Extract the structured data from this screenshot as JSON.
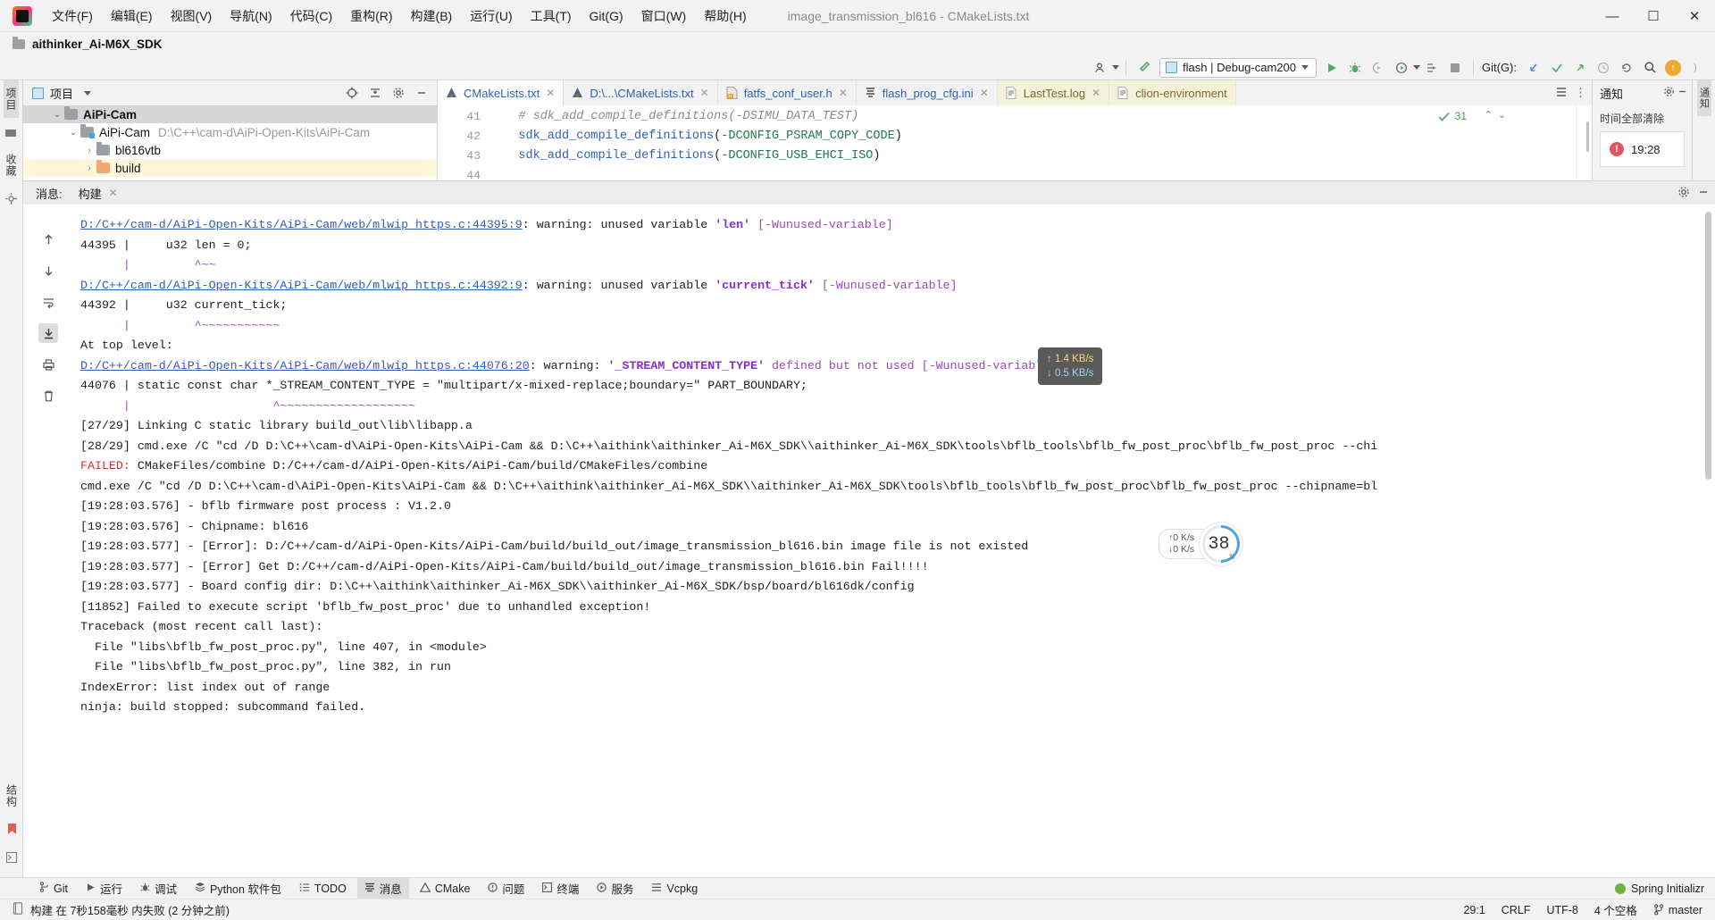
{
  "window": {
    "title": "image_transmission_bl616 - CMakeLists.txt",
    "minimize": "—",
    "maximize": "☐",
    "close": "✕"
  },
  "menu": [
    {
      "label": "文件(F)"
    },
    {
      "label": "编辑(E)"
    },
    {
      "label": "视图(V)"
    },
    {
      "label": "导航(N)"
    },
    {
      "label": "代码(C)"
    },
    {
      "label": "重构(R)"
    },
    {
      "label": "构建(B)"
    },
    {
      "label": "运行(U)"
    },
    {
      "label": "工具(T)"
    },
    {
      "label": "Git(G)"
    },
    {
      "label": "窗口(W)"
    },
    {
      "label": "帮助(H)"
    }
  ],
  "pathbar": {
    "project": "aithinker_Ai-M6X_SDK"
  },
  "toolbar": {
    "run_config": "flash | Debug-cam200",
    "git_label": "Git(G):",
    "update_badge": "↑"
  },
  "left_strip": {
    "project_tab": "项目",
    "bookmarks_tab": "收藏"
  },
  "left_strip_bottom": {
    "structure_tab": "结构"
  },
  "project_panel": {
    "title": "项目",
    "tree": [
      {
        "label": "AiPi-Cam",
        "path": "",
        "depth": 0,
        "arrow": "⌄",
        "icon": "grey",
        "bold": true,
        "selected": true
      },
      {
        "label": "AiPi-Cam",
        "path": "D:\\C++\\cam-d\\AiPi-Open-Kits\\AiPi-Cam",
        "depth": 1,
        "arrow": "⌄",
        "icon": "green",
        "bold": false,
        "selected": false
      },
      {
        "label": "bl616vtb",
        "path": "",
        "depth": 2,
        "arrow": "›",
        "icon": "grey",
        "bold": false,
        "selected": false
      },
      {
        "label": "build",
        "path": "",
        "depth": 2,
        "arrow": "›",
        "icon": "orange",
        "bold": false,
        "selected": false,
        "highlight": true
      }
    ]
  },
  "editor_tabs": [
    {
      "label": "CMakeLists.txt",
      "icon": "cmake",
      "active": true,
      "kind": "code"
    },
    {
      "label": "D:\\...\\CMakeLists.txt",
      "icon": "cmake",
      "active": false,
      "kind": "code"
    },
    {
      "label": "fatfs_conf_user.h",
      "icon": "hfile",
      "active": false,
      "kind": "code"
    },
    {
      "label": "flash_prog_cfg.ini",
      "icon": "ini",
      "active": false,
      "kind": "code"
    },
    {
      "label": "LastTest.log",
      "icon": "log",
      "active": false,
      "kind": "log"
    },
    {
      "label": "clion-environment",
      "icon": "log",
      "active": false,
      "kind": "log"
    }
  ],
  "editor": {
    "inspection_count": "31",
    "lines": [
      {
        "num": "41",
        "segments": [
          {
            "t": "    # sdk_add_compile_definitions(-DSIMU_DATA_TEST)",
            "c": "c-com"
          }
        ]
      },
      {
        "num": "42",
        "segments": [
          {
            "t": "    ",
            "c": "c-plain"
          },
          {
            "t": "sdk_add_compile_definitions",
            "c": "c-fn"
          },
          {
            "t": "(",
            "c": "c-plain"
          },
          {
            "t": "-DCONFIG_PSRAM_COPY_CODE",
            "c": "c-arg"
          },
          {
            "t": ")",
            "c": "c-plain"
          }
        ]
      },
      {
        "num": "43",
        "segments": [
          {
            "t": "    ",
            "c": "c-plain"
          },
          {
            "t": "sdk_add_compile_definitions",
            "c": "c-fn"
          },
          {
            "t": "(",
            "c": "c-plain"
          },
          {
            "t": "-DCONFIG_USB_EHCI_ISO",
            "c": "c-arg"
          },
          {
            "t": ")",
            "c": "c-plain"
          }
        ]
      },
      {
        "num": "44",
        "segments": [
          {
            "t": "",
            "c": "c-plain"
          }
        ]
      }
    ]
  },
  "notifications": {
    "title": "通知",
    "clear_all": "时间全部清除",
    "items": [
      {
        "badge": "!",
        "time": "19:28"
      }
    ]
  },
  "right_strip": {
    "notifications_tab": "通知"
  },
  "build_panel": {
    "label": "消息:",
    "tab": "构建",
    "close": "✕"
  },
  "console": {
    "lines": [
      {
        "type": "link_warn",
        "link": "D:/C++/cam-d/AiPi-Open-Kits/AiPi-Cam/web/mlwip_https.c:44395:9",
        "mid": ": warning: unused variable ",
        "name": "'len'",
        "tail": " [-Wunused-variable]"
      },
      {
        "type": "plain",
        "text": "44395 |     u32 len = 0;"
      },
      {
        "type": "caret",
        "text": "      |         ^~~"
      },
      {
        "type": "link_warn",
        "link": "D:/C++/cam-d/AiPi-Open-Kits/AiPi-Cam/web/mlwip_https.c:44392:9",
        "mid": ": warning: unused variable ",
        "name": "'current_tick'",
        "tail": " [-Wunused-variable]"
      },
      {
        "type": "plain",
        "text": "44392 |     u32 current_tick;"
      },
      {
        "type": "caret",
        "text": "      |         ^~~~~~~~~~~~"
      },
      {
        "type": "plain",
        "text": "At top level:"
      },
      {
        "type": "link_warn",
        "link": "D:/C++/cam-d/AiPi-Open-Kits/AiPi-Cam/web/mlwip_https.c:44076:20",
        "mid": ": warning: ",
        "name": "'_STREAM_CONTENT_TYPE'",
        "tail": " defined but not used [-Wunused-variable]"
      },
      {
        "type": "plain",
        "text": "44076 | static const char *_STREAM_CONTENT_TYPE = \"multipart/x-mixed-replace;boundary=\" PART_BOUNDARY;"
      },
      {
        "type": "caret",
        "text": "      |                    ^~~~~~~~~~~~~~~~~~~~"
      },
      {
        "type": "plain",
        "text": "[27/29] Linking C static library build_out\\lib\\libapp.a"
      },
      {
        "type": "plain",
        "text": "[28/29] cmd.exe /C \"cd /D D:\\C++\\cam-d\\AiPi-Open-Kits\\AiPi-Cam && D:\\C++\\aithink\\aithinker_Ai-M6X_SDK\\\\aithinker_Ai-M6X_SDK\\tools\\bflb_tools\\bflb_fw_post_proc\\bflb_fw_post_proc --chi"
      },
      {
        "type": "failed",
        "prefix": "FAILED: ",
        "text": "CMakeFiles/combine D:/C++/cam-d/AiPi-Open-Kits/AiPi-Cam/build/CMakeFiles/combine"
      },
      {
        "type": "plain",
        "text": "cmd.exe /C \"cd /D D:\\C++\\cam-d\\AiPi-Open-Kits\\AiPi-Cam && D:\\C++\\aithink\\aithinker_Ai-M6X_SDK\\\\aithinker_Ai-M6X_SDK\\tools\\bflb_tools\\bflb_fw_post_proc\\bflb_fw_post_proc --chipname=bl"
      },
      {
        "type": "plain",
        "text": "[19:28:03.576] - bflb firmware post process : V1.2.0"
      },
      {
        "type": "plain",
        "text": "[19:28:03.576] - Chipname: bl616"
      },
      {
        "type": "plain",
        "text": "[19:28:03.577] - [Error]: D:/C++/cam-d/AiPi-Open-Kits/AiPi-Cam/build/build_out/image_transmission_bl616.bin image file is not existed"
      },
      {
        "type": "plain",
        "text": "[19:28:03.577] - [Error] Get D:/C++/cam-d/AiPi-Open-Kits/AiPi-Cam/build/build_out/image_transmission_bl616.bin Fail!!!!"
      },
      {
        "type": "plain",
        "text": "[19:28:03.577] - Board config dir: D:\\C++\\aithink\\aithinker_Ai-M6X_SDK\\\\aithinker_Ai-M6X_SDK/bsp/board/bl616dk/config"
      },
      {
        "type": "plain",
        "text": "[11852] Failed to execute script 'bflb_fw_post_proc' due to unhandled exception!"
      },
      {
        "type": "plain",
        "text": "Traceback (most recent call last):"
      },
      {
        "type": "plain",
        "text": "  File \"libs\\bflb_fw_post_proc.py\", line 407, in <module>"
      },
      {
        "type": "plain",
        "text": "  File \"libs\\bflb_fw_post_proc.py\", line 382, in run"
      },
      {
        "type": "plain",
        "text": "IndexError: list index out of range"
      },
      {
        "type": "plain",
        "text": "ninja: build stopped: subcommand failed."
      }
    ]
  },
  "overlays": {
    "net_badge": {
      "up": "↑ 1.4 KB/s",
      "down": "↓ 0.5 KB/s"
    },
    "ring_widget": {
      "up": "↑0 K/s",
      "down": "↓0 K/s",
      "value": "38",
      "unit": "%"
    }
  },
  "bottom_tabs": [
    {
      "label": "Git",
      "icon": "branch-icon",
      "active": false
    },
    {
      "label": "运行",
      "icon": "play-icon",
      "active": false
    },
    {
      "label": "调试",
      "icon": "bug-icon",
      "active": false
    },
    {
      "label": "Python 软件包",
      "icon": "package-icon",
      "active": false
    },
    {
      "label": "TODO",
      "icon": "list-icon",
      "active": false
    },
    {
      "label": "消息",
      "icon": "messages-icon",
      "active": true
    },
    {
      "label": "CMake",
      "icon": "cmake-icon",
      "active": false
    },
    {
      "label": "问题",
      "icon": "problems-icon",
      "active": false
    },
    {
      "label": "终端",
      "icon": "terminal-icon",
      "active": false
    },
    {
      "label": "服务",
      "icon": "services-icon",
      "active": false
    },
    {
      "label": "Vcpkg",
      "icon": "vcpkg-icon",
      "active": false
    }
  ],
  "bottom_right": {
    "spring": "Spring Initializr"
  },
  "statusbar": {
    "build_status": "构建 在 7秒158毫秒 内失败 (2 分钟之前)",
    "caret": "29:1",
    "line_sep": "CRLF",
    "encoding": "UTF-8",
    "indent": "4 个空格",
    "branch": "master"
  },
  "colors": {
    "accent_blue": "#2f5fb5",
    "error_red": "#cc3333",
    "warn_purple": "#9a4ab5",
    "green": "#59a869"
  }
}
